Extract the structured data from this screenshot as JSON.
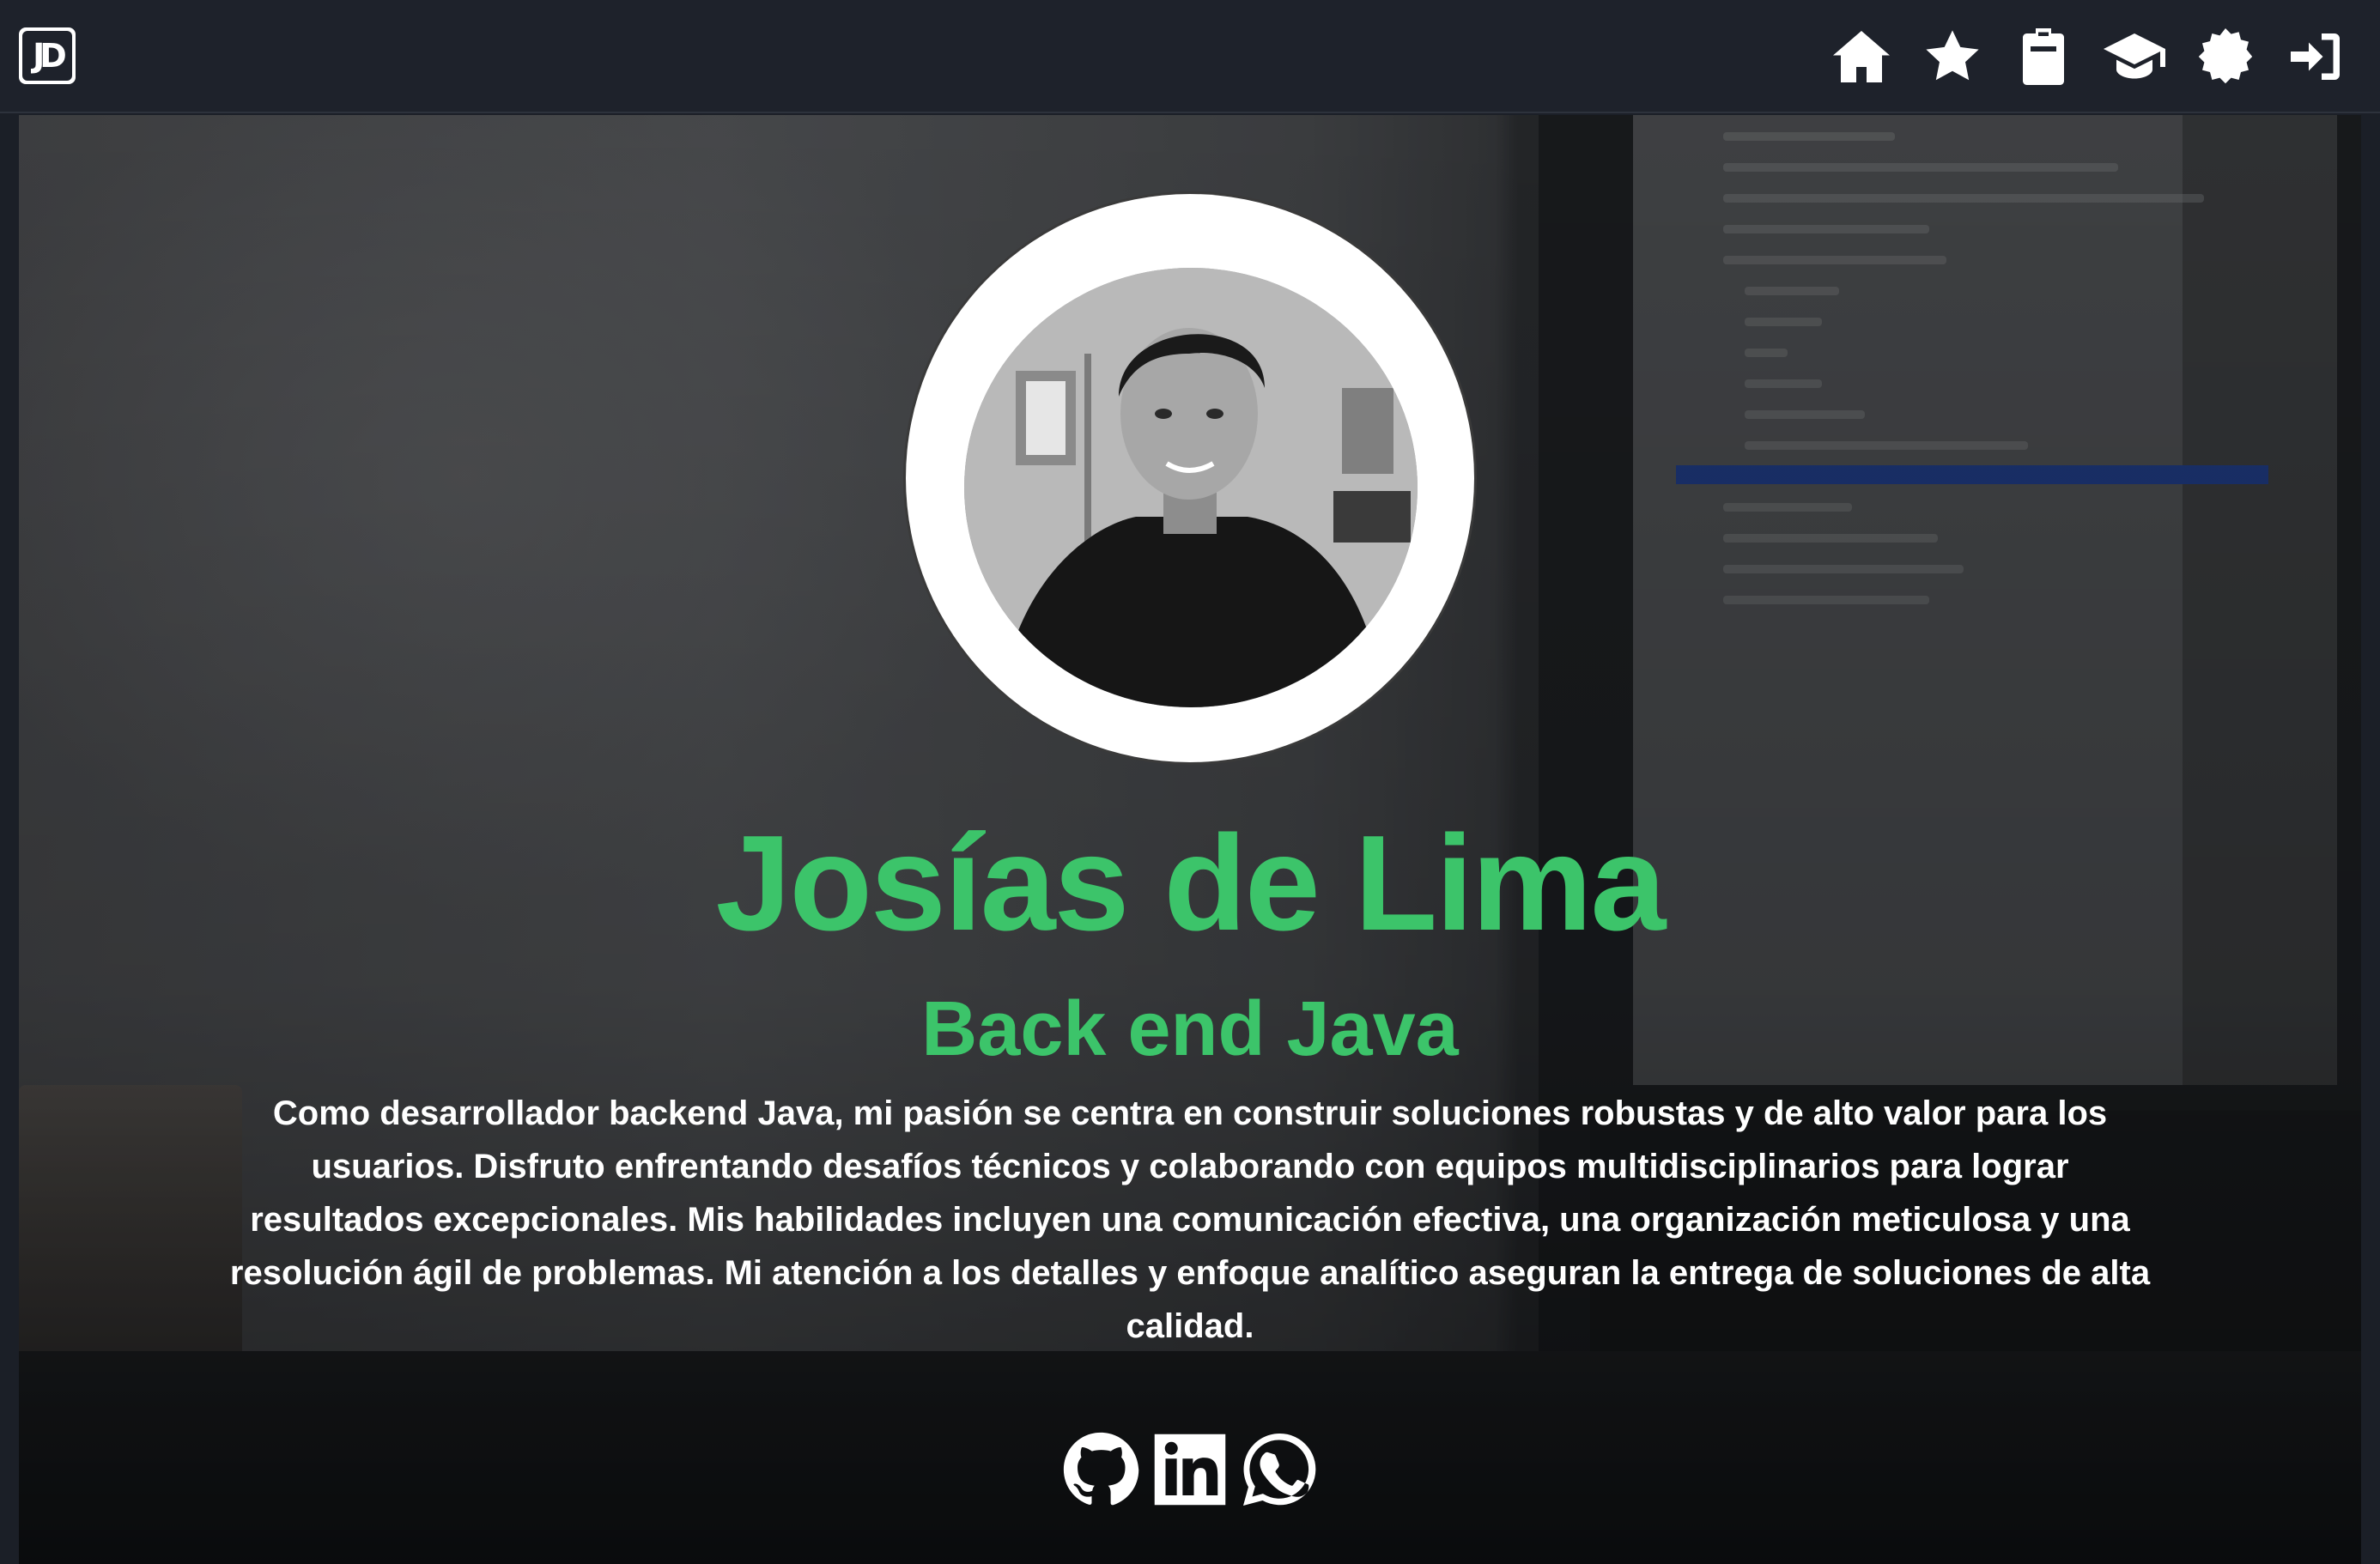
{
  "navbar": {
    "logo_text": "JD",
    "icons": [
      "home-icon",
      "star-icon",
      "clipboard-icon",
      "graduation-cap-icon",
      "gear-badge-icon",
      "sign-in-icon"
    ]
  },
  "profile": {
    "name": "Josías de Lima",
    "role": "Back end Java",
    "bio": "Como desarrollador backend Java, mi pasión se centra en construir soluciones robustas y de alto valor para los usuarios. Disfruto enfrentando desafíos técnicos y colaborando con equipos multidisciplinarios para lograr resultados excepcionales. Mis habilidades incluyen una comunicación efectiva, una organización meticulosa y una resolución ágil de problemas. Mi atención a los detalles y enfoque analítico aseguran la entrega de soluciones de alta calidad."
  },
  "socials": [
    "github-icon",
    "linkedin-icon",
    "whatsapp-icon"
  ],
  "colors": {
    "accent": "#3cc46a",
    "navbar": "#1e222b",
    "text": "#ffffff"
  }
}
